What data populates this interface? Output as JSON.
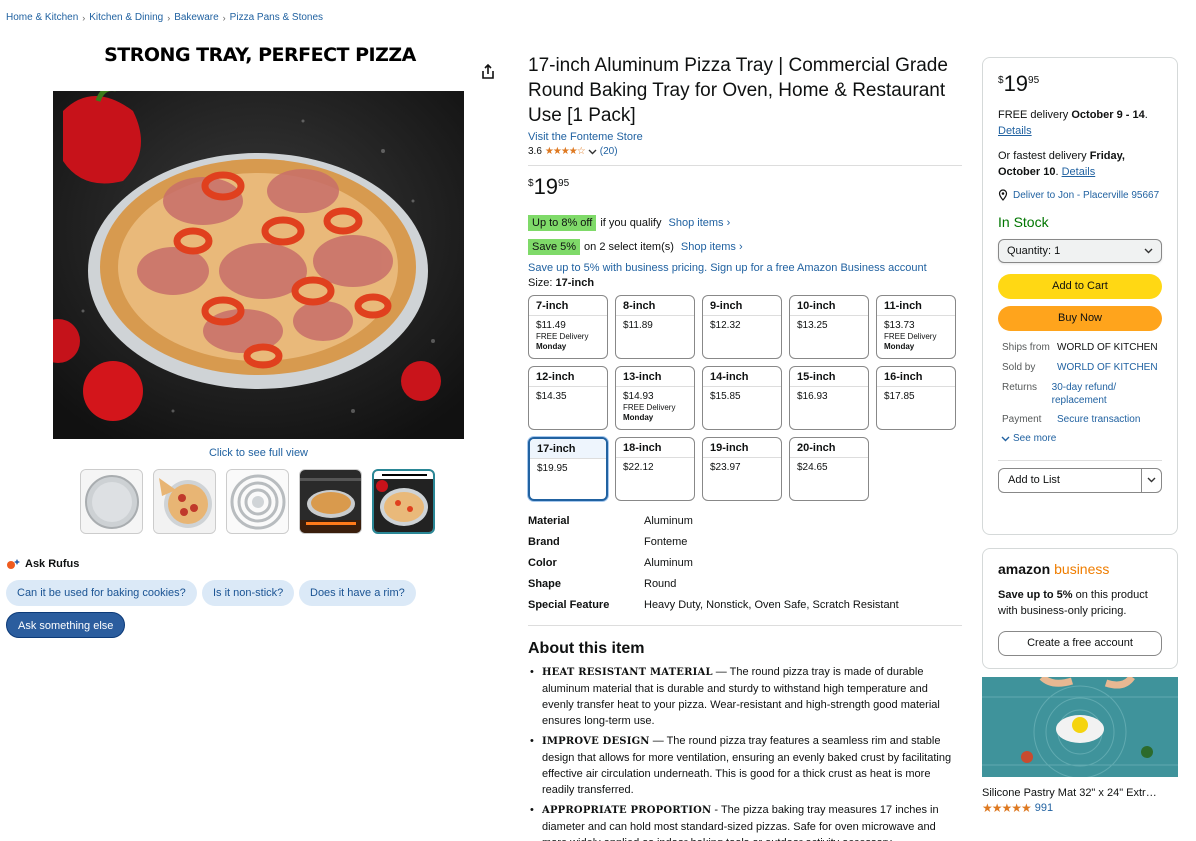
{
  "breadcrumb": [
    "Home & Kitchen",
    "Kitchen & Dining",
    "Bakeware",
    "Pizza Pans & Stones"
  ],
  "banner": "STRONG TRAY, PERFECT PIZZA",
  "media": {
    "click_full": "Click to see full view",
    "thumb_count": 5,
    "selected_thumb": 4
  },
  "rufus": {
    "title": "Ask Rufus",
    "questions": [
      "Can it be used for baking cookies?",
      "Is it non-stick?",
      "Does it have a rim?"
    ],
    "ask_else": "Ask something else"
  },
  "product": {
    "title": "17-inch Aluminum Pizza Tray | Commercial Grade Round Baking Tray for Oven, Home & Restaurant Use [1 Pack]",
    "store": "Visit the Fonteme Store",
    "rating": "3.6",
    "stars": "★★★★☆",
    "reviews": "(20)",
    "price": {
      "sym": "$",
      "whole": "19",
      "frac": "95"
    },
    "promo1": {
      "badge": "Up to 8% off",
      "text": "if you qualify",
      "link": "Shop items ›"
    },
    "promo2": {
      "badge": "Save 5%",
      "text": "on 2 select item(s)",
      "link": "Shop items ›"
    },
    "business": "Save up to 5% with business pricing. Sign up for a free Amazon Business account",
    "size_label": "Size:",
    "size_value": "17-inch",
    "sizes": [
      {
        "name": "7-inch",
        "price": "$11.49",
        "delivery": "FREE Delivery",
        "day": "Monday"
      },
      {
        "name": "8-inch",
        "price": "$11.89",
        "delivery": "",
        "day": ""
      },
      {
        "name": "9-inch",
        "price": "$12.32",
        "delivery": "",
        "day": ""
      },
      {
        "name": "10-inch",
        "price": "$13.25",
        "delivery": "",
        "day": ""
      },
      {
        "name": "11-inch",
        "price": "$13.73",
        "delivery": "FREE Delivery",
        "day": "Monday"
      },
      {
        "name": "12-inch",
        "price": "$14.35",
        "delivery": "",
        "day": ""
      },
      {
        "name": "13-inch",
        "price": "$14.93",
        "delivery": "FREE Delivery",
        "day": "Monday"
      },
      {
        "name": "14-inch",
        "price": "$15.85",
        "delivery": "",
        "day": ""
      },
      {
        "name": "15-inch",
        "price": "$16.93",
        "delivery": "",
        "day": ""
      },
      {
        "name": "16-inch",
        "price": "$17.85",
        "delivery": "",
        "day": ""
      },
      {
        "name": "17-inch",
        "price": "$19.95",
        "delivery": "",
        "day": ""
      },
      {
        "name": "18-inch",
        "price": "$22.12",
        "delivery": "",
        "day": ""
      },
      {
        "name": "19-inch",
        "price": "$23.97",
        "delivery": "",
        "day": ""
      },
      {
        "name": "20-inch",
        "price": "$24.65",
        "delivery": "",
        "day": ""
      }
    ],
    "selected_size": 10,
    "specs": [
      {
        "k": "Material",
        "v": "Aluminum"
      },
      {
        "k": "Brand",
        "v": "Fonteme"
      },
      {
        "k": "Color",
        "v": "Aluminum"
      },
      {
        "k": "Shape",
        "v": "Round"
      },
      {
        "k": "Special Feature",
        "v": "Heavy Duty, Nonstick, Oven Safe, Scratch Resistant"
      }
    ],
    "about_title": "About this item",
    "bullets": [
      {
        "head": "HEAT RESISTANT MATERIAL",
        "body": " — The round pizza tray is made of durable aluminum material that is durable and sturdy to withstand high temperature and evenly transfer heat to your pizza. Wear-resistant and high-strength good material ensures long-term use."
      },
      {
        "head": "IMPROVE DESIGN",
        "body": " — The round pizza tray features a seamless rim and stable design that allows for more ventilation, ensuring an evenly baked crust by facilitating effective air circulation underneath. This is good for a thick crust as heat is more readily transferred."
      },
      {
        "head": "APPROPRIATE PROPORTION",
        "body": " - The pizza baking tray measures 17 inches in diameter and can hold most standard-sized pizzas. Safe for oven microwave and more widely applied as indoor baking tools or outdoor activity accessory"
      }
    ]
  },
  "buybox": {
    "price": {
      "sym": "$",
      "whole": "19",
      "frac": "95"
    },
    "delivery_prefix": "FREE delivery ",
    "delivery_date": "October 9 - 14",
    "delivery_suffix": ".",
    "details": "Details",
    "fastest_prefix": "Or fastest delivery ",
    "fastest_date": "Friday, October 10",
    "fastest_suffix": ". ",
    "deliver_to": "Deliver to Jon - Placerville 95667",
    "stock": "In Stock",
    "quantity": "Quantity: 1",
    "add_cart": "Add to Cart",
    "buy_now": "Buy Now",
    "meta": [
      {
        "k": "Ships from",
        "v": "WORLD OF KITCHEN",
        "link": false
      },
      {
        "k": "Sold by",
        "v": "WORLD OF KITCHEN",
        "link": true
      },
      {
        "k": "Returns",
        "v": "30-day refund/ replacement",
        "link": true
      },
      {
        "k": "Payment",
        "v": "Secure transaction",
        "link": true
      }
    ],
    "see_more": "See more",
    "add_list": "Add to List"
  },
  "bizbox": {
    "logo_a": "amazon",
    "logo_b": "business",
    "text_bold": "Save up to 5%",
    "text": " on this product with business-only pricing.",
    "button": "Create a free account"
  },
  "ad": {
    "title": "Silicone Pastry Mat 32\" x 24\" Extr…",
    "stars": "★★★★★",
    "count": "991"
  },
  "colors": {
    "link": "#2162a1",
    "cart": "#ffd814",
    "buy": "#ffa41c",
    "stock": "#007600",
    "badge": "#7fda69"
  }
}
